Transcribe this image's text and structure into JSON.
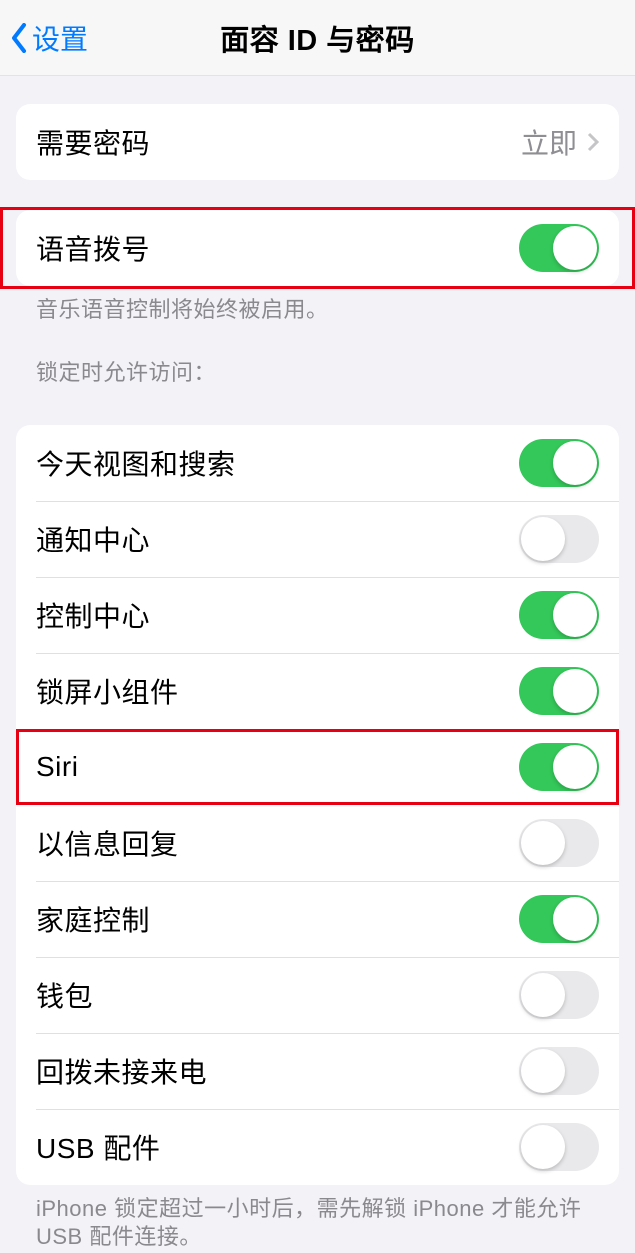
{
  "nav": {
    "back_label": "设置",
    "title": "面容 ID 与密码"
  },
  "passcode": {
    "label": "需要密码",
    "value": "立即"
  },
  "voice_dial": {
    "label": "语音拨号",
    "on": true,
    "footer": "音乐语音控制将始终被启用。"
  },
  "lock_section": {
    "header": "锁定时允许访问：",
    "items": [
      {
        "label": "今天视图和搜索",
        "on": true
      },
      {
        "label": "通知中心",
        "on": false
      },
      {
        "label": "控制中心",
        "on": true
      },
      {
        "label": "锁屏小组件",
        "on": true
      },
      {
        "label": "Siri",
        "on": true
      },
      {
        "label": "以信息回复",
        "on": false
      },
      {
        "label": "家庭控制",
        "on": true
      },
      {
        "label": "钱包",
        "on": false
      },
      {
        "label": "回拨未接来电",
        "on": false
      },
      {
        "label": "USB 配件",
        "on": false
      }
    ],
    "footer": "iPhone 锁定超过一小时后，需先解锁 iPhone 才能允许 USB 配件连接。"
  }
}
